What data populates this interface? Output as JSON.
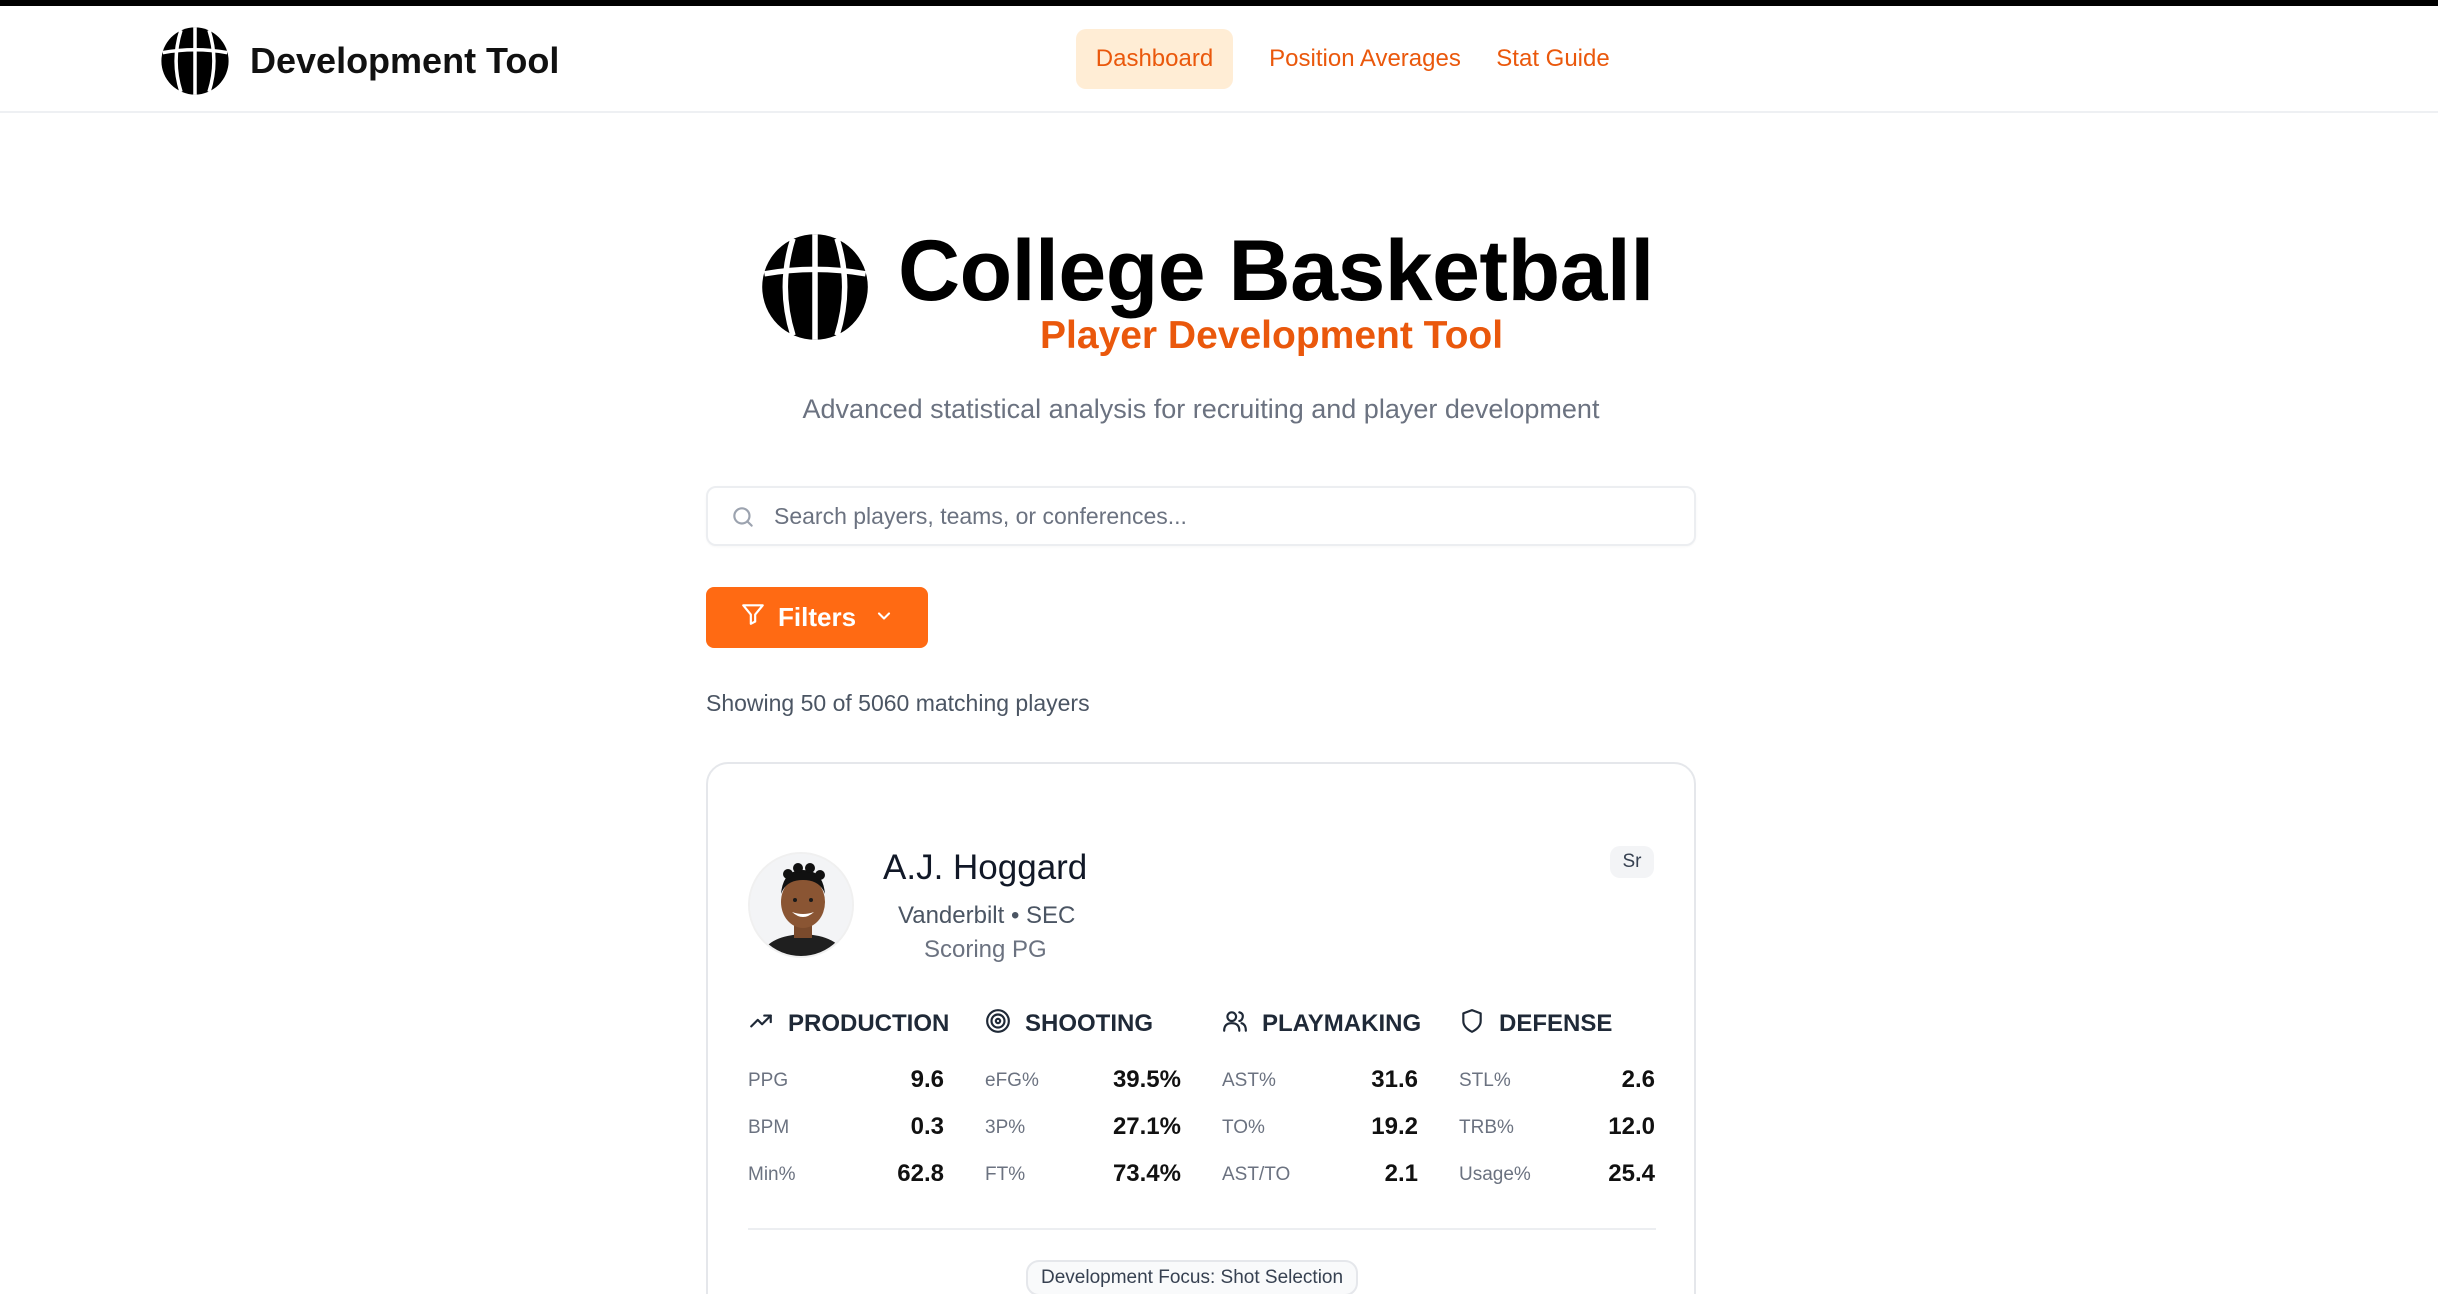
{
  "nav": {
    "brand": "Development Tool",
    "logo_icon": "basketball-icon",
    "items": [
      {
        "label": "Dashboard",
        "active": true
      },
      {
        "label": "Position Averages",
        "active": false
      },
      {
        "label": "Stat Guide",
        "active": false
      }
    ]
  },
  "hero": {
    "title": "College Basketball",
    "subtitle": "Player Development Tool",
    "description": "Advanced statistical analysis for recruiting and player development"
  },
  "search": {
    "placeholder": "Search players, teams, or conferences...",
    "value": ""
  },
  "filters": {
    "label": "Filters"
  },
  "results": {
    "text": "Showing 50 of 5060 matching players"
  },
  "player": {
    "name": "A.J. Hoggard",
    "team_conf": "Vanderbilt • SEC",
    "role": "Scoring PG",
    "class": "Sr",
    "focus": "Development Focus: Shot Selection",
    "groups": [
      {
        "title": "PRODUCTION",
        "icon": "trending-up-icon",
        "stats": [
          {
            "label": "PPG",
            "value": "9.6"
          },
          {
            "label": "BPM",
            "value": "0.3"
          },
          {
            "label": "Min%",
            "value": "62.8"
          }
        ]
      },
      {
        "title": "SHOOTING",
        "icon": "target-icon",
        "stats": [
          {
            "label": "eFG%",
            "value": "39.5%"
          },
          {
            "label": "3P%",
            "value": "27.1%"
          },
          {
            "label": "FT%",
            "value": "73.4%"
          }
        ]
      },
      {
        "title": "PLAYMAKING",
        "icon": "users-icon",
        "stats": [
          {
            "label": "AST%",
            "value": "31.6"
          },
          {
            "label": "TO%",
            "value": "19.2"
          },
          {
            "label": "AST/TO",
            "value": "2.1"
          }
        ]
      },
      {
        "title": "DEFENSE",
        "icon": "shield-icon",
        "stats": [
          {
            "label": "STL%",
            "value": "2.6"
          },
          {
            "label": "TRB%",
            "value": "12.0"
          },
          {
            "label": "Usage%",
            "value": "25.4"
          }
        ]
      }
    ]
  },
  "colors": {
    "accent": "#ea580c",
    "button": "#ff6a13",
    "active_tab_bg": "#ffedd5"
  }
}
